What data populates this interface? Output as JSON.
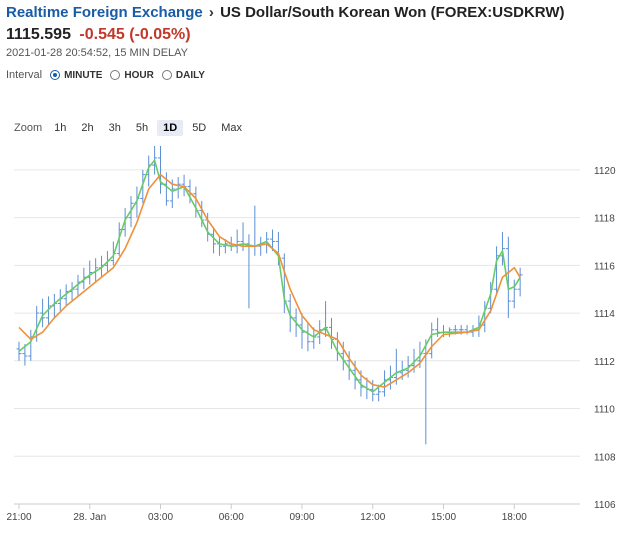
{
  "header": {
    "breadcrumb_link": "Realtime Foreign Exchange",
    "breadcrumb_sep": "›",
    "pair_title": "US Dollar/South Korean Won (FOREX:USDKRW)",
    "price": "1115.595",
    "change": "-0.545 (-0.05%)",
    "timestamp": "2021-01-28 20:54:52, 15 MIN DELAY",
    "change_color": "#c0392b",
    "link_color": "#1a5ba6"
  },
  "interval": {
    "label": "Interval",
    "options": [
      "MINUTE",
      "HOUR",
      "DAILY"
    ],
    "selected": "MINUTE"
  },
  "zoom": {
    "label": "Zoom",
    "options": [
      "1h",
      "2h",
      "3h",
      "5h",
      "1D",
      "5D",
      "Max"
    ],
    "selected": "1D"
  },
  "chart_data": {
    "type": "line",
    "x_tick_labels": [
      "21:00",
      "28. Jan",
      "03:00",
      "06:00",
      "09:00",
      "12:00",
      "15:00",
      "18:00"
    ],
    "y_tick_labels": [
      "1120",
      "1118",
      "1116",
      "1114",
      "1112",
      "1110",
      "1108",
      "1106"
    ],
    "ylim": [
      1106,
      1121
    ],
    "x_hours": [
      0,
      24
    ],
    "grid": true,
    "y_axis_side": "right",
    "colors": {
      "ohlc": "#5b8fd6",
      "fast": "#66cc66",
      "slow": "#f0913a",
      "grid": "#e6e6e6"
    },
    "ohlc": [
      [
        0.0,
        1112.5,
        1112.8,
        1112.0,
        1112.3
      ],
      [
        0.25,
        1112.3,
        1112.7,
        1111.8,
        1112.2
      ],
      [
        0.5,
        1112.2,
        1113.3,
        1112.0,
        1113.0
      ],
      [
        0.75,
        1113.0,
        1114.3,
        1112.8,
        1114.0
      ],
      [
        1.0,
        1114.0,
        1114.6,
        1113.4,
        1113.8
      ],
      [
        1.25,
        1113.8,
        1114.7,
        1113.5,
        1114.3
      ],
      [
        1.5,
        1114.3,
        1114.8,
        1113.8,
        1114.4
      ],
      [
        1.75,
        1114.4,
        1115.0,
        1114.1,
        1114.6
      ],
      [
        2.0,
        1114.6,
        1115.2,
        1114.3,
        1114.9
      ],
      [
        2.25,
        1114.9,
        1115.3,
        1114.5,
        1115.0
      ],
      [
        2.5,
        1115.0,
        1115.6,
        1114.7,
        1115.3
      ],
      [
        2.75,
        1115.3,
        1115.9,
        1115.0,
        1115.5
      ],
      [
        3.0,
        1115.5,
        1116.2,
        1115.2,
        1115.7
      ],
      [
        3.25,
        1115.7,
        1116.3,
        1115.3,
        1115.9
      ],
      [
        3.5,
        1115.9,
        1116.4,
        1115.5,
        1116.0
      ],
      [
        3.75,
        1116.0,
        1116.6,
        1115.7,
        1116.2
      ],
      [
        4.0,
        1116.2,
        1117.0,
        1116.0,
        1116.5
      ],
      [
        4.25,
        1116.5,
        1117.8,
        1116.4,
        1117.5
      ],
      [
        4.5,
        1117.5,
        1118.4,
        1117.2,
        1118.0
      ],
      [
        4.75,
        1118.0,
        1118.9,
        1117.6,
        1118.6
      ],
      [
        5.0,
        1118.6,
        1119.3,
        1118.0,
        1118.8
      ],
      [
        5.25,
        1118.8,
        1120.0,
        1118.6,
        1119.8
      ],
      [
        5.5,
        1119.8,
        1120.6,
        1119.3,
        1120.2
      ],
      [
        5.75,
        1120.2,
        1121.0,
        1119.8,
        1120.5
      ],
      [
        6.0,
        1120.5,
        1121.0,
        1119.0,
        1119.4
      ],
      [
        6.25,
        1119.4,
        1119.9,
        1118.5,
        1118.7
      ],
      [
        6.5,
        1118.7,
        1119.6,
        1118.4,
        1119.2
      ],
      [
        6.75,
        1119.2,
        1119.7,
        1118.8,
        1119.4
      ],
      [
        7.0,
        1119.4,
        1119.8,
        1118.9,
        1119.3
      ],
      [
        7.25,
        1119.3,
        1119.6,
        1118.6,
        1119.0
      ],
      [
        7.5,
        1119.0,
        1119.3,
        1118.0,
        1118.3
      ],
      [
        7.75,
        1118.3,
        1118.7,
        1117.6,
        1117.9
      ],
      [
        8.0,
        1117.9,
        1118.2,
        1117.0,
        1117.3
      ],
      [
        8.25,
        1117.3,
        1117.6,
        1116.5,
        1116.9
      ],
      [
        8.5,
        1116.9,
        1117.2,
        1116.4,
        1116.8
      ],
      [
        8.75,
        1116.8,
        1117.1,
        1116.5,
        1116.9
      ],
      [
        9.0,
        1116.9,
        1117.2,
        1116.6,
        1116.8
      ],
      [
        9.25,
        1116.8,
        1117.5,
        1116.5,
        1117.0
      ],
      [
        9.5,
        1117.0,
        1117.8,
        1116.6,
        1116.9
      ],
      [
        9.75,
        1116.9,
        1117.3,
        1114.2,
        1116.8
      ],
      [
        10.0,
        1116.8,
        1118.5,
        1116.4,
        1116.8
      ],
      [
        10.25,
        1116.8,
        1117.2,
        1116.4,
        1116.9
      ],
      [
        10.5,
        1116.9,
        1117.4,
        1116.5,
        1117.1
      ],
      [
        10.75,
        1117.1,
        1117.5,
        1116.6,
        1117.0
      ],
      [
        11.0,
        1117.0,
        1117.4,
        1116.0,
        1116.3
      ],
      [
        11.25,
        1116.3,
        1116.5,
        1114.0,
        1114.5
      ],
      [
        11.5,
        1114.5,
        1114.8,
        1113.2,
        1113.8
      ],
      [
        11.75,
        1113.8,
        1114.2,
        1113.0,
        1113.5
      ],
      [
        12.0,
        1113.5,
        1114.0,
        1112.5,
        1113.2
      ],
      [
        12.25,
        1113.2,
        1113.6,
        1112.4,
        1112.8
      ],
      [
        12.5,
        1112.8,
        1113.4,
        1112.5,
        1113.0
      ],
      [
        12.75,
        1113.0,
        1113.7,
        1112.7,
        1113.3
      ],
      [
        13.0,
        1113.3,
        1114.5,
        1113.0,
        1113.4
      ],
      [
        13.25,
        1113.4,
        1113.8,
        1112.5,
        1112.9
      ],
      [
        13.5,
        1112.9,
        1113.2,
        1112.0,
        1112.3
      ],
      [
        13.75,
        1112.3,
        1112.8,
        1111.6,
        1112.0
      ],
      [
        14.0,
        1112.0,
        1112.4,
        1111.2,
        1111.6
      ],
      [
        14.25,
        1111.6,
        1112.0,
        1110.8,
        1111.2
      ],
      [
        14.5,
        1111.2,
        1111.6,
        1110.5,
        1110.9
      ],
      [
        14.75,
        1110.9,
        1111.3,
        1110.4,
        1110.8
      ],
      [
        15.0,
        1110.8,
        1111.2,
        1110.3,
        1110.6
      ],
      [
        15.25,
        1110.6,
        1111.0,
        1110.3,
        1110.7
      ],
      [
        15.5,
        1110.7,
        1111.6,
        1110.5,
        1111.2
      ],
      [
        15.75,
        1111.2,
        1111.8,
        1110.8,
        1111.3
      ],
      [
        16.0,
        1111.3,
        1112.5,
        1111.0,
        1111.5
      ],
      [
        16.25,
        1111.5,
        1112.0,
        1111.2,
        1111.6
      ],
      [
        16.5,
        1111.6,
        1112.2,
        1111.3,
        1111.8
      ],
      [
        16.75,
        1111.8,
        1112.5,
        1111.5,
        1112.0
      ],
      [
        17.0,
        1112.0,
        1112.8,
        1111.7,
        1112.3
      ],
      [
        17.25,
        1112.3,
        1112.9,
        1108.5,
        1112.3
      ],
      [
        17.5,
        1112.3,
        1113.6,
        1112.1,
        1113.3
      ],
      [
        17.75,
        1113.3,
        1113.8,
        1113.0,
        1113.2
      ],
      [
        18.0,
        1113.2,
        1113.5,
        1113.0,
        1113.2
      ],
      [
        18.25,
        1113.2,
        1113.4,
        1113.0,
        1113.3
      ],
      [
        18.5,
        1113.3,
        1113.5,
        1113.1,
        1113.3
      ],
      [
        18.75,
        1113.3,
        1113.5,
        1113.1,
        1113.3
      ],
      [
        19.0,
        1113.3,
        1113.5,
        1113.1,
        1113.2
      ],
      [
        19.25,
        1113.2,
        1113.5,
        1113.0,
        1113.3
      ],
      [
        19.5,
        1113.3,
        1113.9,
        1113.0,
        1113.5
      ],
      [
        19.75,
        1113.5,
        1114.5,
        1113.2,
        1114.2
      ],
      [
        20.0,
        1114.2,
        1115.3,
        1114.0,
        1115.0
      ],
      [
        20.25,
        1115.0,
        1116.8,
        1114.8,
        1116.4
      ],
      [
        20.5,
        1116.4,
        1117.4,
        1116.0,
        1116.7
      ],
      [
        20.75,
        1116.7,
        1117.2,
        1113.8,
        1114.5
      ],
      [
        21.0,
        1114.5,
        1115.4,
        1114.2,
        1115.0
      ],
      [
        21.25,
        1115.0,
        1115.9,
        1114.7,
        1115.6
      ]
    ],
    "series": [
      {
        "values": [
          [
            0.0,
            1112.4
          ],
          [
            0.5,
            1112.8
          ],
          [
            1.0,
            1113.9
          ],
          [
            1.5,
            1114.4
          ],
          [
            2.0,
            1114.8
          ],
          [
            2.5,
            1115.2
          ],
          [
            3.0,
            1115.6
          ],
          [
            3.5,
            1115.9
          ],
          [
            4.0,
            1116.4
          ],
          [
            4.5,
            1117.9
          ],
          [
            5.0,
            1118.7
          ],
          [
            5.5,
            1120.1
          ],
          [
            5.75,
            1120.4
          ],
          [
            6.0,
            1119.5
          ],
          [
            6.5,
            1119.1
          ],
          [
            7.0,
            1119.3
          ],
          [
            7.5,
            1118.4
          ],
          [
            8.0,
            1117.4
          ],
          [
            8.5,
            1116.9
          ],
          [
            9.0,
            1116.8
          ],
          [
            9.5,
            1116.9
          ],
          [
            10.0,
            1116.8
          ],
          [
            10.5,
            1117.0
          ],
          [
            11.0,
            1116.4
          ],
          [
            11.25,
            1114.6
          ],
          [
            11.5,
            1113.9
          ],
          [
            12.0,
            1113.3
          ],
          [
            12.5,
            1113.0
          ],
          [
            13.0,
            1113.4
          ],
          [
            13.5,
            1112.4
          ],
          [
            14.0,
            1111.7
          ],
          [
            14.5,
            1111.0
          ],
          [
            15.0,
            1110.7
          ],
          [
            15.5,
            1111.1
          ],
          [
            16.0,
            1111.5
          ],
          [
            16.5,
            1111.7
          ],
          [
            17.0,
            1112.2
          ],
          [
            17.5,
            1113.1
          ],
          [
            18.0,
            1113.2
          ],
          [
            19.0,
            1113.2
          ],
          [
            19.5,
            1113.4
          ],
          [
            20.0,
            1114.8
          ],
          [
            20.25,
            1116.2
          ],
          [
            20.5,
            1116.6
          ],
          [
            20.75,
            1115.0
          ],
          [
            21.0,
            1115.1
          ],
          [
            21.25,
            1115.5
          ]
        ]
      },
      {
        "values": [
          [
            0.0,
            1113.4
          ],
          [
            0.5,
            1112.9
          ],
          [
            1.0,
            1113.2
          ],
          [
            1.5,
            1113.8
          ],
          [
            2.0,
            1114.3
          ],
          [
            2.5,
            1114.7
          ],
          [
            3.0,
            1115.1
          ],
          [
            3.5,
            1115.5
          ],
          [
            4.0,
            1115.9
          ],
          [
            4.5,
            1116.7
          ],
          [
            5.0,
            1117.8
          ],
          [
            5.5,
            1119.2
          ],
          [
            6.0,
            1119.8
          ],
          [
            6.5,
            1119.4
          ],
          [
            7.0,
            1119.3
          ],
          [
            7.5,
            1118.8
          ],
          [
            8.0,
            1117.9
          ],
          [
            8.5,
            1117.2
          ],
          [
            9.0,
            1116.9
          ],
          [
            9.5,
            1116.8
          ],
          [
            10.0,
            1116.8
          ],
          [
            10.5,
            1116.9
          ],
          [
            11.0,
            1116.5
          ],
          [
            11.5,
            1115.0
          ],
          [
            12.0,
            1113.9
          ],
          [
            12.5,
            1113.3
          ],
          [
            13.0,
            1113.1
          ],
          [
            13.5,
            1112.9
          ],
          [
            14.0,
            1112.1
          ],
          [
            14.5,
            1111.4
          ],
          [
            15.0,
            1111.0
          ],
          [
            15.5,
            1110.9
          ],
          [
            16.0,
            1111.2
          ],
          [
            16.5,
            1111.5
          ],
          [
            17.0,
            1111.9
          ],
          [
            17.5,
            1112.6
          ],
          [
            18.0,
            1113.1
          ],
          [
            19.0,
            1113.2
          ],
          [
            19.5,
            1113.3
          ],
          [
            20.0,
            1114.1
          ],
          [
            20.5,
            1115.5
          ],
          [
            21.0,
            1115.9
          ],
          [
            21.25,
            1115.5
          ]
        ]
      }
    ]
  }
}
